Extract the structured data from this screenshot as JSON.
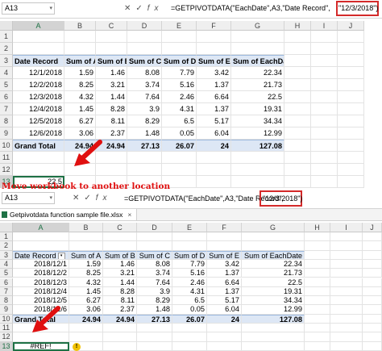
{
  "top": {
    "name_box": "A13",
    "formula": "=GETPIVOTDATA(\"EachDate\",A3,\"Date Record\",",
    "formula_highlight": "\"12/3/2018\")",
    "columns": [
      "A",
      "B",
      "C",
      "D",
      "E",
      "F",
      "G",
      "H",
      "I",
      "J"
    ],
    "rows": [
      "1",
      "2",
      "3",
      "4",
      "5",
      "6",
      "7",
      "8",
      "9",
      "10",
      "11",
      "12",
      "13"
    ],
    "headers": [
      "Date Record",
      "Sum of A",
      "Sum of B",
      "Sum of C",
      "Sum of D",
      "Sum of E",
      "Sum of EachDate"
    ],
    "data": [
      [
        "12/1/2018",
        "1.59",
        "1.46",
        "8.08",
        "7.79",
        "3.42",
        "22.34"
      ],
      [
        "12/2/2018",
        "8.25",
        "3.21",
        "3.74",
        "5.16",
        "1.37",
        "21.73"
      ],
      [
        "12/3/2018",
        "4.32",
        "1.44",
        "7.64",
        "2.46",
        "6.64",
        "22.5"
      ],
      [
        "12/4/2018",
        "1.45",
        "8.28",
        "3.9",
        "4.31",
        "1.37",
        "19.31"
      ],
      [
        "12/5/2018",
        "6.27",
        "8.11",
        "8.29",
        "6.5",
        "5.17",
        "34.34"
      ],
      [
        "12/6/2018",
        "3.06",
        "2.37",
        "1.48",
        "0.05",
        "6.04",
        "12.99"
      ]
    ],
    "total": [
      "Grand Total",
      "24.94",
      "24.94",
      "27.13",
      "26.07",
      "24",
      "127.08"
    ],
    "result": "22.5"
  },
  "banner": "Move workbook to another location",
  "bottom": {
    "name_box": "A13",
    "formula": "=GETPIVOTDATA(\"EachDate\",A3,\"Date Record\",",
    "formula_highlight": "\"12/3/2018\")",
    "tab_label": "Getpivotdata function sample file.xlsx",
    "tab_close": "×",
    "headers": [
      "Date Record",
      "Sum of A",
      "Sum of B",
      "Sum of C",
      "Sum of D",
      "Sum of E",
      "Sum of EachDate"
    ],
    "data": [
      [
        "2018/12/1",
        "1.59",
        "1.46",
        "8.08",
        "7.79",
        "3.42",
        "22.34"
      ],
      [
        "2018/12/2",
        "8.25",
        "3.21",
        "3.74",
        "5.16",
        "1.37",
        "21.73"
      ],
      [
        "2018/12/3",
        "4.32",
        "1.44",
        "7.64",
        "2.46",
        "6.64",
        "22.5"
      ],
      [
        "2018/12/4",
        "1.45",
        "8.28",
        "3.9",
        "4.31",
        "1.37",
        "19.31"
      ],
      [
        "2018/12/5",
        "6.27",
        "8.11",
        "8.29",
        "6.5",
        "5.17",
        "34.34"
      ],
      [
        "2018/12/6",
        "3.06",
        "2.37",
        "1.48",
        "0.05",
        "6.04",
        "12.99"
      ]
    ],
    "total": [
      "Grand Total",
      "24.94",
      "24.94",
      "27.13",
      "26.07",
      "24",
      "127.08"
    ],
    "result": "#REF!"
  },
  "colors": {
    "arrow": "#e01010",
    "highlight_box": "#d42a2a",
    "pivot_fill": "#dde7f5",
    "selection": "#1e7145"
  },
  "icons": {
    "cancel": "close-icon",
    "enter": "check-icon",
    "fx": "fx-icon",
    "arrow": "red-arrow-icon",
    "warning": "error-warning-icon"
  }
}
